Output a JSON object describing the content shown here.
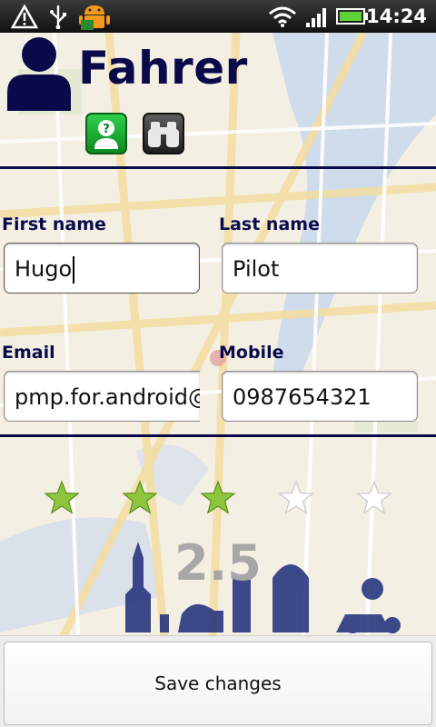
{
  "status_bar": {
    "time": "14:24",
    "icons": [
      "warning-icon",
      "usb-icon",
      "android-icon",
      "wifi-icon",
      "signal-icon",
      "battery-icon"
    ]
  },
  "header": {
    "title": "Fahrer",
    "icons": [
      "person-icon",
      "help-icon",
      "binoculars-icon"
    ]
  },
  "form": {
    "first_name": {
      "label": "First name",
      "value": "Hugo"
    },
    "last_name": {
      "label": "Last name",
      "value": "Pilot"
    },
    "email": {
      "label": "Email",
      "value": "pmp.for.android@"
    },
    "mobile": {
      "label": "Mobile",
      "value": "0987654321"
    }
  },
  "rating": {
    "value": 2.5,
    "value_text": "2.5",
    "max": 5,
    "filled": 3,
    "filled_color": "#8cc63f",
    "empty_color": "#ffffff"
  },
  "footer": {
    "save_label": "Save changes"
  },
  "colors": {
    "title": "#0a0a4a",
    "divider": "#0a0a4a",
    "help_button": "#1cb53a"
  }
}
